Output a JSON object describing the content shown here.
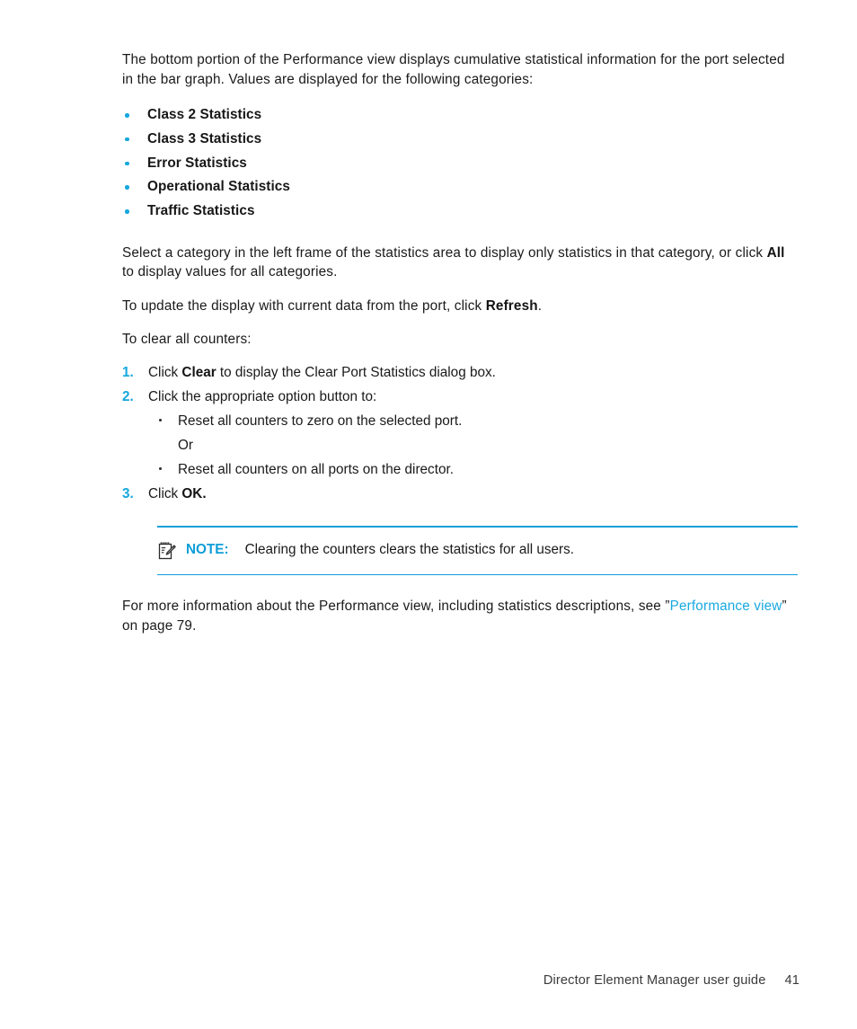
{
  "document": {
    "intro_paragraph": "The bottom portion of the Performance view displays cumulative statistical information for the port selected in the bar graph. Values are displayed for the following categories:",
    "categories": [
      {
        "label": "Class 2 Statistics"
      },
      {
        "label": "Class 3 Statistics"
      },
      {
        "label": "Error Statistics"
      },
      {
        "label": "Operational Statistics"
      },
      {
        "label": "Traffic Statistics"
      }
    ],
    "select_paragraph": {
      "part1": "Select a category in the left frame of the statistics area to display only statistics in that category, or click ",
      "bold1": "All",
      "part2": " to display values for all categories."
    },
    "refresh_paragraph": {
      "part1": "To update the display with current data from the port, click ",
      "bold1": "Refresh",
      "part2": "."
    },
    "clear_lead_in": "To clear all counters:",
    "steps": [
      {
        "number": "1.",
        "part1": "Click ",
        "bold1": "Clear",
        "part2": " to display the Clear Port Statistics dialog box."
      },
      {
        "number": "2.",
        "part1": "Click the appropriate option button to:",
        "bold1": "",
        "part2": "",
        "substeps": [
          {
            "text": "Reset all counters to zero on the selected port.",
            "bulleted": true
          },
          {
            "text": "Or",
            "bulleted": false
          },
          {
            "text": "Reset all counters on all ports on the director.",
            "bulleted": true
          }
        ]
      },
      {
        "number": "3.",
        "part1": "Click ",
        "bold1": "OK.",
        "part2": ""
      }
    ],
    "note": {
      "icon": "note-pad-pencil-icon",
      "label": "NOTE:",
      "text": "Clearing the counters clears the statistics for all users."
    },
    "more_info": {
      "part1": "For more information about the Performance view, including statistics descriptions, see ”",
      "link": "Performance view",
      "part2": "” on page 79."
    }
  },
  "footer": {
    "guide_title": "Director Element Manager user guide",
    "page_number": "41"
  },
  "colors": {
    "accent_cyan": "#15a7dd",
    "note_rule": "#0e9ed8",
    "link": "#1aa9e0",
    "body_text": "#1a1a1a"
  }
}
